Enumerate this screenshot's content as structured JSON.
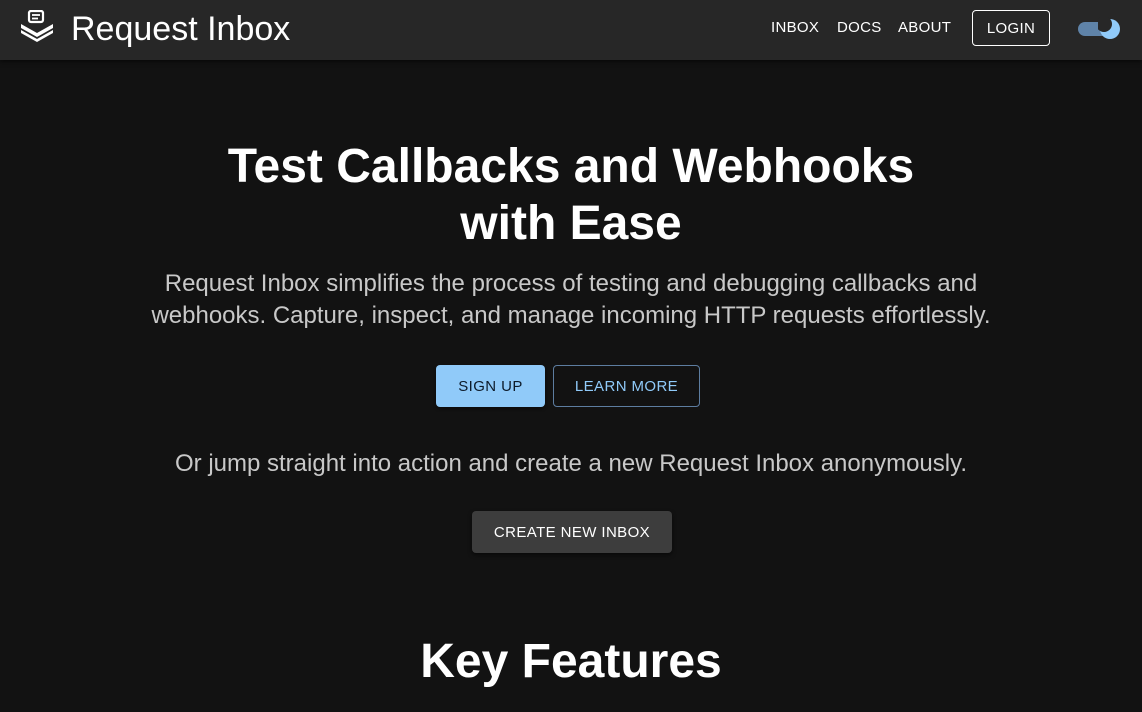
{
  "header": {
    "brand_title": "Request Inbox",
    "brand_icon": "inbox-stack-icon",
    "nav": [
      {
        "label": "INBOX"
      },
      {
        "label": "DOCS"
      },
      {
        "label": "ABOUT"
      }
    ],
    "login_label": "LOGIN",
    "theme_toggle": {
      "icon": "moon-icon",
      "state": "dark",
      "accent": "#90caf9"
    }
  },
  "hero": {
    "title_line1": "Test Callbacks and Webhooks",
    "title_line2": "with Ease",
    "subtitle_line1": "Request Inbox simplifies the process of testing and debugging callbacks and",
    "subtitle_line2": "webhooks. Capture, inspect, and manage incoming HTTP requests effortlessly.",
    "signup_label": "SIGN UP",
    "learn_more_label": "LEARN MORE",
    "anonymous_text": "Or jump straight into action and create a new Request Inbox anonymously.",
    "create_inbox_label": "CREATE NEW INBOX"
  },
  "features": {
    "title": "Key Features"
  },
  "colors": {
    "background": "#121212",
    "appbar": "#272727",
    "primary": "#90caf9",
    "secondary_button": "#3d3d3d"
  }
}
